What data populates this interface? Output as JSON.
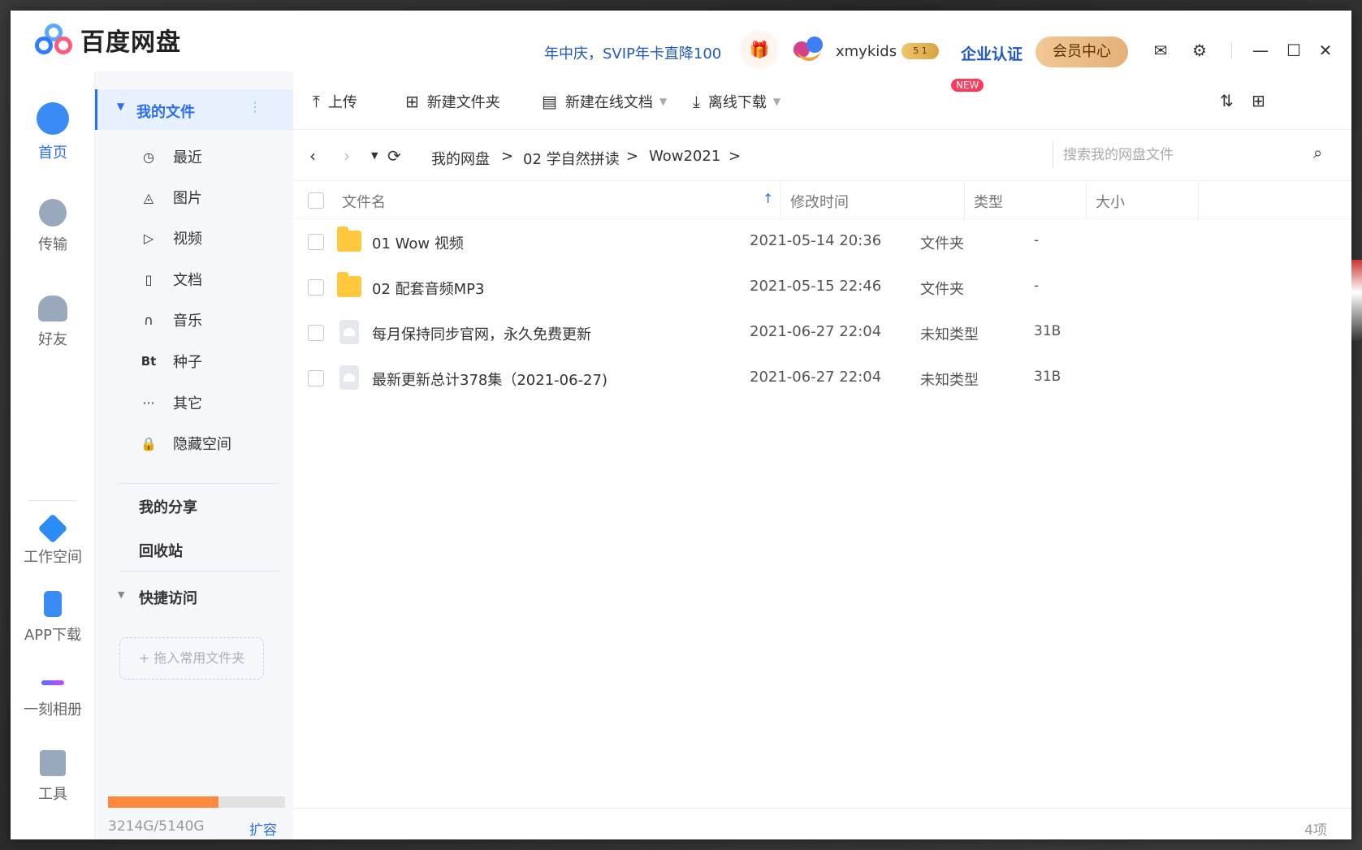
{
  "app": {
    "title": "百度网盘",
    "promo": "年中庆，SVIP年卡直降100",
    "username": "xmykids",
    "vip_level": "5 1",
    "enterprise": "企业认证",
    "member_center": "会员中心"
  },
  "rail": {
    "items": [
      {
        "label": "首页",
        "icon": "cloud-icon",
        "active": true
      },
      {
        "label": "传输",
        "icon": "transfer-icon",
        "active": false
      },
      {
        "label": "好友",
        "icon": "friends-icon",
        "active": false
      },
      {
        "label": "工作空间",
        "icon": "workspace-icon",
        "active": false
      },
      {
        "label": "APP下载",
        "icon": "phone-icon",
        "active": false
      },
      {
        "label": "一刻相册",
        "icon": "album-icon",
        "active": false
      },
      {
        "label": "工具",
        "icon": "tools-icon",
        "active": false
      }
    ]
  },
  "sidebar": {
    "my_files": "我的文件",
    "items": [
      {
        "label": "最近",
        "icon": "clock-icon",
        "glyph": "◷"
      },
      {
        "label": "图片",
        "icon": "image-icon",
        "glyph": "◬"
      },
      {
        "label": "视频",
        "icon": "video-icon",
        "glyph": "▷"
      },
      {
        "label": "文档",
        "icon": "document-icon",
        "glyph": "▯"
      },
      {
        "label": "音乐",
        "icon": "headphones-icon",
        "glyph": "∩"
      },
      {
        "label": "种子",
        "icon": "torrent-icon",
        "glyph": "Bt"
      },
      {
        "label": "其它",
        "icon": "more-icon",
        "glyph": "···"
      },
      {
        "label": "隐藏空间",
        "icon": "lock-icon",
        "glyph": "🔒"
      }
    ],
    "my_share": "我的分享",
    "recycle": "回收站",
    "quick_access": "快捷访问",
    "drop_hint": "+ 拖入常用文件夹",
    "quota_text": "3214G/5140G",
    "quota_used_fraction": 0.625,
    "expand": "扩容"
  },
  "toolbar": {
    "upload": "上传",
    "new_folder": "新建文件夹",
    "new_online_doc": "新建在线文档",
    "new_badge": "NEW",
    "offline_download": "离线下载"
  },
  "breadcrumb": [
    "我的网盘",
    "02 学自然拼读",
    "Wow2021"
  ],
  "search": {
    "placeholder": "搜索我的网盘文件"
  },
  "table": {
    "headers": {
      "name": "文件名",
      "modified": "修改时间",
      "type": "类型",
      "size": "大小"
    },
    "rows": [
      {
        "name": "01 Wow 视频",
        "modified": "2021-05-14 20:36",
        "type": "文件夹",
        "size": "-",
        "kind": "folder"
      },
      {
        "name": "02 配套音频MP3",
        "modified": "2021-05-15 22:46",
        "type": "文件夹",
        "size": "-",
        "kind": "folder"
      },
      {
        "name": "每月保持同步官网，永久免费更新",
        "modified": "2021-06-27 22:04",
        "type": "未知类型",
        "size": "31B",
        "kind": "file"
      },
      {
        "name": "最新更新总计378集（2021-06-27)",
        "modified": "2021-06-27 22:04",
        "type": "未知类型",
        "size": "31B",
        "kind": "file"
      }
    ]
  },
  "footer": {
    "count": "4项"
  },
  "colors": {
    "accent": "#2b6ef5",
    "quota": "#ff8a3d",
    "folder": "#ffc83d"
  }
}
